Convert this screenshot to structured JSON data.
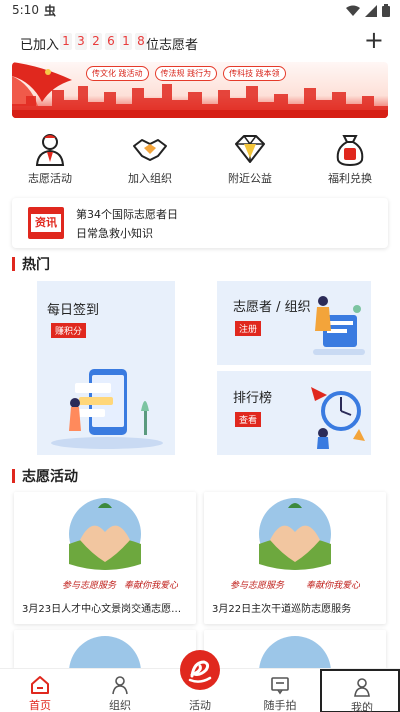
{
  "status_bar": {
    "time": "5:10",
    "app_icon": "虫"
  },
  "header": {
    "prefix": "已加入",
    "digits": [
      "1",
      "3",
      "2",
      "6",
      "1",
      "8"
    ],
    "suffix": "位志愿者",
    "plus_label": "+"
  },
  "banner": {
    "tags": [
      "传文化 践活动",
      "传法规 践行为",
      "传科技 践本领"
    ]
  },
  "quick_actions": [
    {
      "label": "志愿活动",
      "icon": "volunteer-icon"
    },
    {
      "label": "加入组织",
      "icon": "handshake-icon"
    },
    {
      "label": "附近公益",
      "icon": "diamond-icon"
    },
    {
      "label": "福利兑换",
      "icon": "money-bag-icon"
    }
  ],
  "news": {
    "badge": "资讯",
    "line1": "第34个国际志愿者日",
    "line2": "日常急救小知识"
  },
  "hot": {
    "title": "热门",
    "checkin": {
      "title": "每日签到",
      "tag": "赚积分"
    },
    "register": {
      "title": "志愿者 / 组织",
      "tag": "注册"
    },
    "ranking": {
      "title": "排行榜",
      "tag": "查看"
    }
  },
  "activities": {
    "title": "志愿活动",
    "items": [
      {
        "caption": "3月23日人才中心文景岗交通志愿服...",
        "slogan_left": "参与志愿服务",
        "slogan_right": "奉献你我爱心"
      },
      {
        "caption": "3月22日主次干道巡防志愿服务",
        "slogan_left": "参与志愿服务",
        "slogan_right": "奉献你我爱心"
      }
    ]
  },
  "bottom_nav": [
    {
      "label": "首页",
      "icon": "home-icon",
      "active": true
    },
    {
      "label": "组织",
      "icon": "person-icon",
      "active": false
    },
    {
      "label": "活动",
      "icon": "activity-icon",
      "active": false
    },
    {
      "label": "随手拍",
      "icon": "message-icon",
      "active": false
    },
    {
      "label": "我的",
      "icon": "profile-icon",
      "active": false
    }
  ],
  "colors": {
    "accent": "#e0281e",
    "card_bg": "#e8f0fb"
  }
}
